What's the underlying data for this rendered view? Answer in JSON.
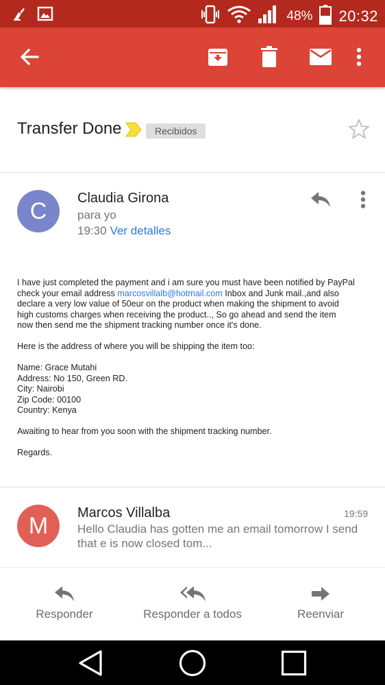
{
  "status_bar": {
    "battery_percent": "48%",
    "time": "20:32"
  },
  "app_bar": {
    "color": "#db4437",
    "actions": [
      "back-arrow-icon",
      "archive-icon",
      "delete-icon",
      "mark-unread-icon",
      "more-vert-icon"
    ]
  },
  "thread": {
    "subject": "Transfer Done",
    "label": "Recibidos",
    "starred": false
  },
  "message1": {
    "avatar_letter": "C",
    "avatar_color": "#7986cb",
    "sender": "Claudia Girona",
    "to": "para yo",
    "time": "19:30",
    "details_link": "Ver detalles",
    "body": {
      "p1_l1": "I have just completed the payment and i am sure you must have been notified by PayPal",
      "p1_l2_pre": "check your email address ",
      "p1_email": "marcosvillalb@hotmail.com",
      "p1_l2_post": " Inbox and Junk mail.,and also",
      "p1_l3": "declare a very low value of 50eur on the product when making the shipment to avoid",
      "p1_l4": "high customs charges when receiving the product.., So go ahead and send the item",
      "p1_l5": "now then send me the shipment tracking number once it's done.",
      "p2": "Here is the address of where you will be shipping the item too:",
      "name": "Name: Grace Mutahi",
      "address": "Address: No 150, Green RD.",
      "city": "City: Nairobi",
      "zip": "Zip Code: 00100",
      "country": "Country: Kenya",
      "p4": "Awaiting to hear from you soon with the shipment tracking number.",
      "p5": "Regards."
    }
  },
  "message2": {
    "avatar_letter": "M",
    "avatar_color": "#e06055",
    "sender": "Marcos Villalba",
    "time": "19:59",
    "snippet": "Hello Claudia has gotten me an email tomorrow I send that e is now closed tom..."
  },
  "actions": {
    "reply": "Responder",
    "reply_all": "Responder a todos",
    "forward": "Reenviar"
  }
}
